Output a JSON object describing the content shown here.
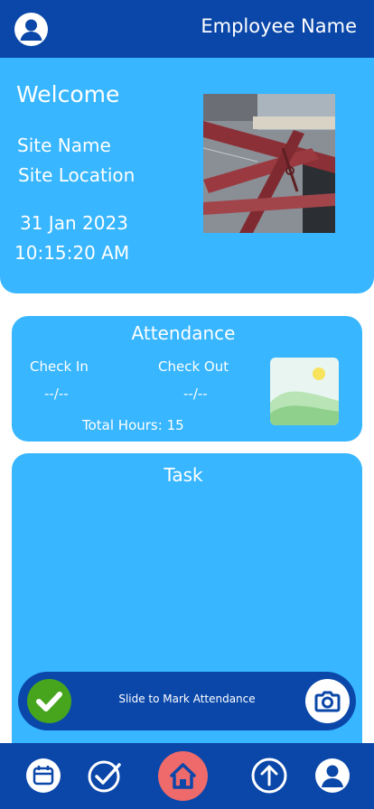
{
  "header": {
    "employee_name": "Employee Name",
    "avatar_icon": "user-avatar-icon"
  },
  "hero": {
    "welcome": "Welcome",
    "site_name": "Site Name",
    "site_location": "Site Location",
    "date": "31 Jan 2023",
    "time": "10:15:20 AM"
  },
  "attendance": {
    "title": "Attendance",
    "check_in_label": "Check In",
    "check_out_label": "Check Out",
    "check_in_value": "--/--",
    "check_out_value": "--/--",
    "total_hours": "Total Hours: 15"
  },
  "task": {
    "title": "Task"
  },
  "slider": {
    "label": "Slide to Mark Attendance"
  },
  "nav": {
    "items": [
      "calendar-icon",
      "check-circle-icon",
      "home-icon",
      "upload-icon",
      "profile-icon"
    ]
  },
  "colors": {
    "primary_dark": "#0a47a9",
    "primary_light": "#38b6ff",
    "success": "#47a51d",
    "home_accent": "#ef6a6a"
  }
}
